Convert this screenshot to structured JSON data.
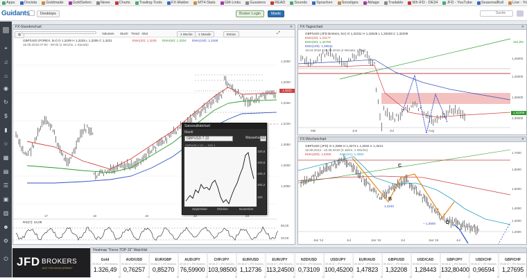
{
  "bookmarks": [
    "Apps",
    "Onvista",
    "Goldmade",
    "GoldSeiten",
    "News",
    "Charts",
    "Trading-Tools",
    "FX-Makler",
    "MT4-Stats",
    "GM-Links",
    "Gussiens",
    "READ",
    "Sounds",
    "Sprachen",
    "Sonstiges",
    "Ablage",
    "Tradable",
    "Wh iFD - DE34",
    "JFD - YouTube",
    "SeasonalBull",
    "Live - YouTube"
  ],
  "header": {
    "logo": "Guidants",
    "desktop_btn": "Desktops",
    "new_tab": "Broker Login",
    "active_btn": "Markt",
    "search": "Suche"
  },
  "chart1": {
    "title": "FX-Stundenchart",
    "toolbar": [
      "Indikator",
      "Volumen",
      "Stoch",
      "Trend",
      "Abst"
    ],
    "toolbar2": [
      "1 Woche",
      "1 Stunde",
      "Extras"
    ],
    "symbol": "GBP/USD (FOREX, bcr)  O 1,3209  H 1,3225  L 1,3205  C 1,3221",
    "ema20": "EMA(20): 1,3226",
    "ema50": "EMA(50): 1,3204",
    "ema100": "EMA(100): 1,3168",
    "daterange": "15.08.2016 07:00 - 09:00 (1 Woche, 1 Stunde)",
    "yticks": [
      "1,3250",
      "1,3200",
      "1,3150",
      "1,3100",
      "1,3050",
      "1,3000",
      "1,2950",
      "1,2900",
      "1,2850"
    ],
    "price": "1,3221",
    "xticks": [
      "17",
      "18",
      "19",
      "22",
      "23"
    ],
    "rsi": "RSI(7): 44,09",
    "rsi_ticks": [
      "80,00",
      "20,00"
    ]
  },
  "chart2": {
    "title": "FX-Tageschart",
    "symbol": "GBP/USD (JFD Brokers, bcr)  O 1,32311  H 1,32528  L 1,32028  C 1,32209",
    "lines": [
      "EMA(20): 1,31177",
      "EMA(50): 1,32765",
      "EMA(100): 1,35641"
    ],
    "daterange": "18.04.2016 - 25.08.2016 (4 Monate, 1 Tag)",
    "yticks": [
      "1,45000",
      "1,40000",
      "1,35000",
      "1,30000"
    ],
    "fib": "161,8%",
    "price": "1,32209",
    "xticks": [
      "Mai",
      "Jun",
      "Jul",
      "Aug"
    ]
  },
  "chart3": {
    "title": "FX-Wochenchart",
    "symbol": "GBP/USD (JFD)  O 1,3069  H 1,3273  L 1,3032  C 1,3221",
    "daterange": "15.08.2013 - 22.08.2016 (3 Jahre, 1 Woche)",
    "lines": [
      "EMA(200): 1,5259",
      "EMA(21): 1,3684"
    ],
    "yticks": [
      "1,7000",
      "1,6000",
      "1,5000",
      "1,4000",
      "1,3000",
      "1,2000"
    ],
    "labels": {
      "C": "C",
      "B": "B",
      "D": "D",
      "b_val": "1,4240",
      "d_val": "~ 1,3500"
    },
    "xticks": [
      "Jan '14",
      "Jul",
      "Jan '15",
      "Jul",
      "Jan '16",
      "Jul"
    ]
  },
  "popup": {
    "title": "Saisonalitätchart",
    "tab": "Markt",
    "symbol": "GBPUSD-7.22",
    "mode": "Wassehage",
    "years": "60",
    "legend": "GBPUSD-7.22 — 10% 1",
    "yticks": [
      "100,8",
      "100,6",
      "100,4",
      "100,2",
      "100"
    ],
    "xticks": [
      "September",
      "Oktober",
      "November"
    ]
  },
  "watchlist": {
    "title": "Heatmap \"Forex-TOP-15\" Watchlist",
    "items": [
      {
        "name": "Gold",
        "sub": "09.08.47 | JFD Brokers",
        "price": "1.326,49"
      },
      {
        "name": "AUD/USD",
        "sub": "09.08.47 | JFD Brokers",
        "price": "0,76257"
      },
      {
        "name": "EUR/GBP",
        "sub": "09.08.47 | JFD Brokers",
        "price": "0,85270"
      },
      {
        "name": "AUD/JPY",
        "sub": "09.08.47 | JFD Brokers",
        "price": "76,59900"
      },
      {
        "name": "CHF/JPY",
        "sub": "09.08.47 | JFD Brokers",
        "price": "103,98500"
      },
      {
        "name": "EUR/USD",
        "sub": "09.08.47 | JFD Brokers",
        "price": "1,12736"
      },
      {
        "name": "EUR/JPY",
        "sub": "09.08.47 | JFD Brokers",
        "price": "113,24500"
      },
      {
        "name": "NZD/USD",
        "sub": "09.08.47 | JFD Brokers",
        "price": "0,73109"
      },
      {
        "name": "USD/JPY",
        "sub": "09.08.47 | JFD Brokers",
        "price": "100,45200"
      },
      {
        "name": "EUR/AUD",
        "sub": "09.08.47 | JFD Brokers",
        "price": "1,47823"
      },
      {
        "name": "GBP/USD",
        "sub": "09.08.47 | JFD Brokers",
        "price": "1,32208"
      },
      {
        "name": "USD/CAD",
        "sub": "09.08.47 | JFD Brokers",
        "price": "1,28443"
      },
      {
        "name": "GBP/JPY",
        "sub": "09.08.47 | JFD Brokers",
        "price": "132,80400"
      },
      {
        "name": "USD/CHF",
        "sub": "09.08.47 | JFD Brokers",
        "price": "0,96594"
      },
      {
        "name": "GBP/CHF",
        "sub": "09.08.47 | JFD Brokers",
        "price": "1,27695"
      }
    ]
  },
  "brand": {
    "name": "JFD",
    "name2": "BROKERS",
    "tagline": "JUST FOR DEVELOPMENT"
  },
  "colors": {
    "ema20": "#d04040",
    "ema50": "#2a9a2a",
    "ema100": "#3050c0",
    "zone": "#f1b2b2"
  }
}
